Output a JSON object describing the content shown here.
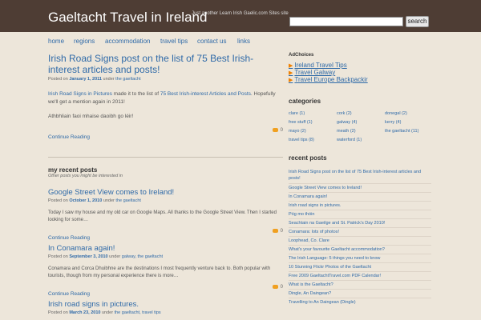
{
  "header": {
    "site_title": "Gaeltacht Travel in Ireland",
    "tagline": "Just another Learn Irish Gaelic.com Sites site",
    "search_placeholder": "",
    "search_button": "search"
  },
  "nav": [
    "home",
    "regions",
    "accommodation",
    "travel tips",
    "contact us",
    "links"
  ],
  "featured_post": {
    "title": "Irish Road Signs post on the list of 75 Best Irish-interest articles and posts!",
    "meta_posted": "Posted on",
    "meta_date": "January 1, 2011",
    "meta_under": "under",
    "meta_category": "the gaeltacht",
    "body_link": "Irish Road Signs in Pictures",
    "body_text": " made it to the list of ",
    "body_link2": "75 Best Irish-interest Articles and Posts",
    "body_text2": ". Hopefully we'll get a mention again in 2011!",
    "body_para2": "Athbhliain faoi mhaise daoibh go léir!",
    "continue": "Continue Reading",
    "comments": "0"
  },
  "recent": {
    "heading": "my recent posts",
    "subheading": "Other posts you might be interested in",
    "posts": [
      {
        "title": "Google Street View comes to Ireland!",
        "posted": "Posted on",
        "date": "October 1, 2010",
        "under": "under",
        "categories": "the gaeltacht",
        "excerpt": "Today I saw my house and my old car on Google Maps. All thanks to the Google Street View. Then I started looking for some…",
        "continue": "Continue Reading",
        "comments": "0"
      },
      {
        "title": "In Conamara again!",
        "posted": "Posted on",
        "date": "September 3, 2010",
        "under": "under",
        "categories": "galway, the gaeltacht",
        "excerpt": "Conamara and Corca Dhuibhne are the destinations I most frequently venture back to. Both popular with tourists, though from my personal experience there is more…",
        "continue": "Continue Reading",
        "comments": "0"
      },
      {
        "title": "Irish road signs in pictures.",
        "posted": "Posted on",
        "date": "March 23, 2010",
        "under": "under",
        "categories": "the gaeltacht, travel tips"
      }
    ]
  },
  "sidebar": {
    "adchoices": "AdChoices",
    "ad_arrow": "▶",
    "ads": [
      "Ireland Travel Tips",
      "Travel Galway",
      "Travel Europe Backpackir"
    ],
    "categories_heading": "categories",
    "categories": [
      "clare (1)",
      "cork (2)",
      "donegal (2)",
      "free stuff (1)",
      "galway (4)",
      "kerry (4)",
      "mayo (2)",
      "meath (2)",
      "the gaeltacht (11)",
      "travel tips (8)",
      "waterford (1)"
    ],
    "recent_heading": "recent posts",
    "recent_posts": [
      "Irish Road Signs post on the list of 75 Best Irish-interest articles and posts!",
      "Google Street View comes to Ireland!",
      "In Conamara again!",
      "Irish road signs in pictures.",
      "Póg mo thóin",
      "Seachtain na Gaeilge and St. Patrick's Day 2010!",
      "Conamara: lots of photos!",
      "Loophead, Co. Clare",
      "What's your favourite Gaeltacht accommodation?",
      "The Irish Language: 5 things you need to know",
      "10 Stunning Flickr Photos of the Gaeltacht",
      "Free 2009 GaeltachtTravel.com PDF Calendar!",
      "What is the Gaeltacht?",
      "Dingle, An Daingean?",
      "Travelling to An Daingean (Dingle)"
    ]
  }
}
